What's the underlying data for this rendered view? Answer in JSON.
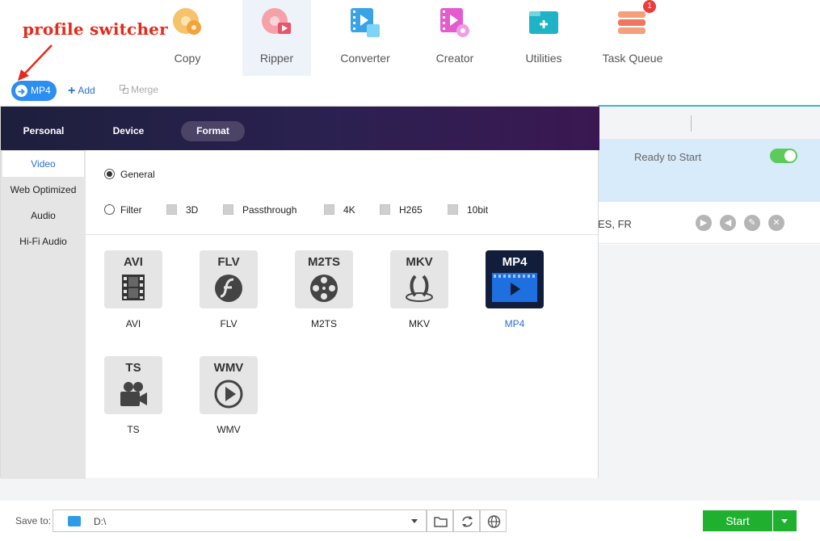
{
  "annotation": {
    "text": "profile switcher",
    "color": "#e52a1c"
  },
  "nav": {
    "items": [
      {
        "label": "Copy",
        "icon": "copy-disc-icon"
      },
      {
        "label": "Ripper",
        "icon": "ripper-disc-icon",
        "active": true
      },
      {
        "label": "Converter",
        "icon": "converter-film-icon"
      },
      {
        "label": "Creator",
        "icon": "creator-film-icon"
      },
      {
        "label": "Utilities",
        "icon": "utilities-toolbox-icon"
      },
      {
        "label": "Task Queue",
        "icon": "task-queue-icon"
      }
    ],
    "task_queue_badge": "1"
  },
  "toolbar": {
    "profile_label": "MP4",
    "add_label": "Add",
    "merge_label": "Merge"
  },
  "background_task": {
    "status": "Ready to Start",
    "languages": "ES, FR",
    "toggle_on": true
  },
  "profile_panel": {
    "tabs": [
      {
        "label": "Personal"
      },
      {
        "label": "Device"
      },
      {
        "label": "Format",
        "active": true
      }
    ],
    "categories": [
      {
        "label": "Video",
        "active": true
      },
      {
        "label": "Web Optimized"
      },
      {
        "label": "Audio"
      },
      {
        "label": "Hi-Fi Audio"
      }
    ],
    "modes": {
      "general": "General",
      "filter": "Filter",
      "selected": "General"
    },
    "filters": [
      "3D",
      "Passthrough",
      "4K",
      "H265",
      "10bit"
    ],
    "formats": [
      {
        "tag": "AVI",
        "label": "AVI",
        "icon": "film-strip-icon"
      },
      {
        "tag": "FLV",
        "label": "FLV",
        "icon": "flash-icon"
      },
      {
        "tag": "M2TS",
        "label": "M2TS",
        "icon": "film-reel-icon"
      },
      {
        "tag": "MKV",
        "label": "MKV",
        "icon": "matroska-icon"
      },
      {
        "tag": "MP4",
        "label": "MP4",
        "icon": "play-film-icon",
        "selected": true
      },
      {
        "tag": "TS",
        "label": "TS",
        "icon": "video-camera-icon"
      },
      {
        "tag": "WMV",
        "label": "WMV",
        "icon": "play-circle-icon"
      }
    ]
  },
  "footer": {
    "save_label": "Save to:",
    "path": "D:\\",
    "start_label": "Start"
  },
  "colors": {
    "accent_blue": "#2b8ef0",
    "start_green": "#1fb02f",
    "panel_header_dark": "#1d1f3d",
    "badge_red": "#ec3b3b",
    "toggle_green": "#5ccb5c",
    "selection_blue": "#d7ebfb"
  }
}
